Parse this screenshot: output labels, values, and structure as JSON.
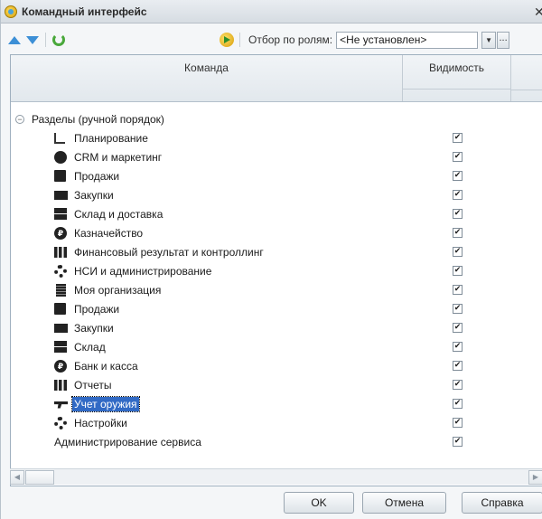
{
  "window": {
    "title": "Командный интерфейс",
    "close": "✕"
  },
  "toolbar": {
    "filter_label": "Отбор по ролям:",
    "filter_value": "<Не установлен>",
    "more_label": "..."
  },
  "grid": {
    "col_command": "Команда",
    "col_visibility": "Видимость",
    "group": {
      "toggle": "−",
      "label": "Разделы (ручной порядок)"
    },
    "items": [
      {
        "label": "Планирование",
        "icon": "planning-icon",
        "checked": true
      },
      {
        "label": "CRM и маркетинг",
        "icon": "crm-icon",
        "checked": true
      },
      {
        "label": "Продажи",
        "icon": "bag-icon",
        "checked": true
      },
      {
        "label": "Закупки",
        "icon": "cart-icon",
        "checked": true
      },
      {
        "label": "Склад и доставка",
        "icon": "warehouse-icon",
        "checked": true
      },
      {
        "label": "Казначейство",
        "icon": "coin-icon",
        "checked": true
      },
      {
        "label": "Финансовый результат и контроллинг",
        "icon": "bars-icon",
        "checked": true
      },
      {
        "label": "НСИ и администрирование",
        "icon": "gear-icon",
        "checked": true
      },
      {
        "label": "Моя организация",
        "icon": "building-icon",
        "checked": true
      },
      {
        "label": "Продажи",
        "icon": "bag-icon",
        "checked": true
      },
      {
        "label": "Закупки",
        "icon": "cart-icon",
        "checked": true
      },
      {
        "label": "Склад",
        "icon": "warehouse-icon",
        "checked": true
      },
      {
        "label": "Банк и касса",
        "icon": "coin-icon",
        "checked": true
      },
      {
        "label": "Отчеты",
        "icon": "bars-icon",
        "checked": true
      },
      {
        "label": "Учет оружия",
        "icon": "gun-icon",
        "checked": true,
        "selected": true
      },
      {
        "label": "Настройки",
        "icon": "gear-icon",
        "checked": true
      }
    ],
    "plain_item": {
      "label": "Администрирование сервиса",
      "checked": true
    },
    "check_mark": "✔"
  },
  "buttons": {
    "ok": "OK",
    "cancel": "Отмена",
    "help": "Справка"
  },
  "colors": {
    "selection": "#316ac5",
    "accent": "#3c8fd6"
  }
}
